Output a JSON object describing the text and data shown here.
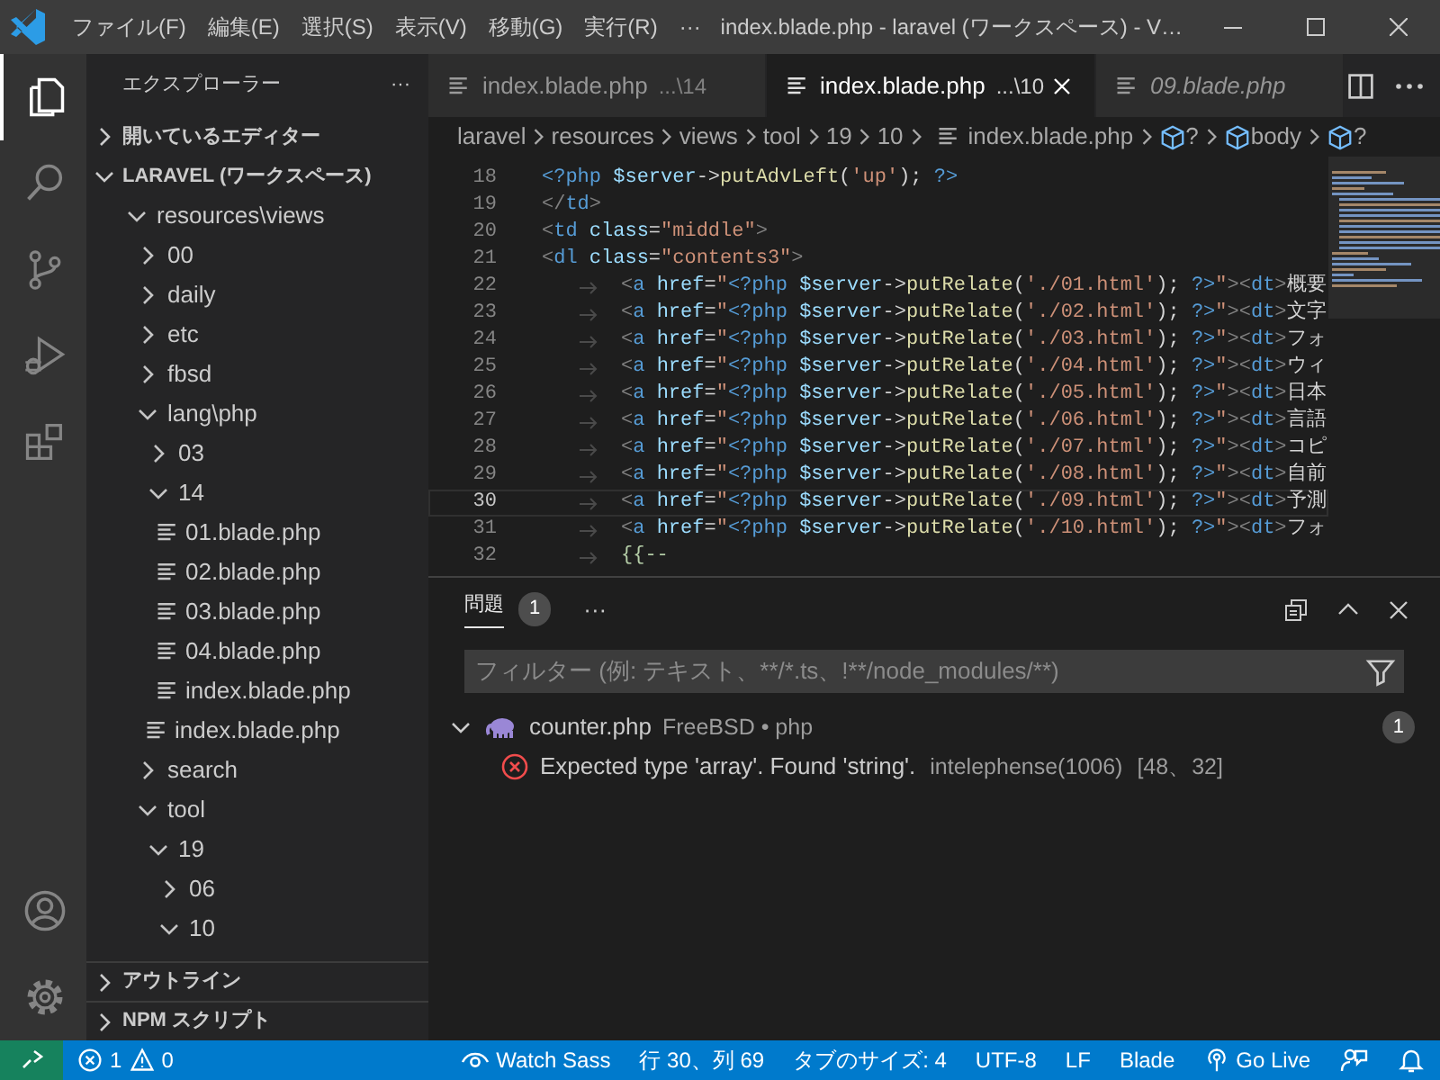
{
  "title_bar": {
    "menu": [
      "ファイル(F)",
      "編集(E)",
      "選択(S)",
      "表示(V)",
      "移動(G)",
      "実行(R)"
    ],
    "more": "···",
    "title": "index.blade.php - laravel (ワークスペース) - V…"
  },
  "activity_bar": {
    "top": [
      {
        "kind": "explorer",
        "selected": true
      },
      {
        "kind": "search",
        "selected": false
      },
      {
        "kind": "source-control",
        "selected": false
      },
      {
        "kind": "debug",
        "selected": false
      },
      {
        "kind": "extensions",
        "selected": false
      }
    ],
    "bottom": [
      {
        "kind": "account"
      },
      {
        "kind": "settings"
      }
    ]
  },
  "sidebar": {
    "title": "エクスプローラー",
    "more": "···",
    "open_editors": {
      "label": "開いているエディター",
      "expanded": false
    },
    "workspace": {
      "label": "LARAVEL (ワークスペース)",
      "expanded": true,
      "tree": [
        {
          "label": "resources\\views",
          "kind": "folder",
          "expanded": true,
          "children": [
            {
              "label": "00",
              "kind": "folder",
              "expanded": false
            },
            {
              "label": "daily",
              "kind": "folder",
              "expanded": false
            },
            {
              "label": "etc",
              "kind": "folder",
              "expanded": false
            },
            {
              "label": "fbsd",
              "kind": "folder",
              "expanded": false
            },
            {
              "label": "lang\\php",
              "kind": "folder",
              "expanded": true,
              "children": [
                {
                  "label": "03",
                  "kind": "folder",
                  "expanded": false
                },
                {
                  "label": "14",
                  "kind": "folder",
                  "expanded": true,
                  "children": [
                    {
                      "label": "01.blade.php",
                      "kind": "file"
                    },
                    {
                      "label": "02.blade.php",
                      "kind": "file"
                    },
                    {
                      "label": "03.blade.php",
                      "kind": "file"
                    },
                    {
                      "label": "04.blade.php",
                      "kind": "file"
                    },
                    {
                      "label": "index.blade.php",
                      "kind": "file"
                    }
                  ]
                },
                {
                  "label": "index.blade.php",
                  "kind": "file"
                }
              ]
            },
            {
              "label": "search",
              "kind": "folder",
              "expanded": false
            },
            {
              "label": "tool",
              "kind": "folder",
              "expanded": true,
              "children": [
                {
                  "label": "19",
                  "kind": "folder",
                  "expanded": true,
                  "children": [
                    {
                      "label": "06",
                      "kind": "folder",
                      "expanded": false
                    },
                    {
                      "label": "10",
                      "kind": "folder",
                      "expanded": true
                    }
                  ]
                }
              ]
            }
          ]
        }
      ]
    },
    "bottom_sections": [
      {
        "label": "アウトライン",
        "expanded": false
      },
      {
        "label": "NPM スクリプト",
        "expanded": false
      }
    ]
  },
  "editor": {
    "tabs": [
      {
        "label": "index.blade.php",
        "description": "...\\14",
        "selected": false,
        "preview": false
      },
      {
        "label": "index.blade.php",
        "description": "...\\10",
        "selected": true,
        "preview": false
      },
      {
        "label": "09.blade.php",
        "selected": false,
        "preview": true
      }
    ],
    "breadcrumb": [
      {
        "label": "laravel",
        "kind": "folder"
      },
      {
        "label": "resources",
        "kind": "folder"
      },
      {
        "label": "views",
        "kind": "folder"
      },
      {
        "label": "tool",
        "kind": "folder"
      },
      {
        "label": "19",
        "kind": "folder"
      },
      {
        "label": "10",
        "kind": "folder"
      },
      {
        "label": "index.blade.php",
        "kind": "file"
      },
      {
        "label": "?",
        "kind": "symbol"
      },
      {
        "label": "body",
        "kind": "symbol"
      },
      {
        "label": "?",
        "kind": "symbol"
      }
    ],
    "lines": [
      {
        "number": "18",
        "indent": false,
        "current": false,
        "tokens": [
          {
            "text": "<?php",
            "kind": "tag"
          },
          {
            "text": " $server",
            "kind": "var"
          },
          {
            "text": "->",
            "kind": "op"
          },
          {
            "text": "putAdvLeft",
            "kind": "fn"
          },
          {
            "text": "(",
            "kind": "op"
          },
          {
            "text": "'up'",
            "kind": "str"
          },
          {
            "text": ");",
            "kind": "op"
          },
          {
            "text": " ?>",
            "kind": "tag"
          }
        ]
      },
      {
        "number": "19",
        "indent": false,
        "current": false,
        "tokens": [
          {
            "text": "</",
            "kind": "punc"
          },
          {
            "text": "td",
            "kind": "tag"
          },
          {
            "text": ">",
            "kind": "punc"
          }
        ]
      },
      {
        "number": "20",
        "indent": false,
        "current": false,
        "tokens": [
          {
            "text": "<",
            "kind": "punc"
          },
          {
            "text": "td",
            "kind": "tag"
          },
          {
            "text": " class",
            "kind": "attr"
          },
          {
            "text": "=",
            "kind": "op"
          },
          {
            "text": "\"middle\"",
            "kind": "str"
          },
          {
            "text": ">",
            "kind": "punc"
          }
        ]
      },
      {
        "number": "21",
        "indent": false,
        "current": false,
        "tokens": [
          {
            "text": "<",
            "kind": "punc"
          },
          {
            "text": "dl",
            "kind": "tag"
          },
          {
            "text": " class",
            "kind": "attr"
          },
          {
            "text": "=",
            "kind": "op"
          },
          {
            "text": "\"contents3\"",
            "kind": "str"
          },
          {
            "text": ">",
            "kind": "punc"
          }
        ]
      },
      {
        "number": "22",
        "indent": true,
        "current": false,
        "tokens": [
          {
            "text": "<",
            "kind": "punc"
          },
          {
            "text": "a",
            "kind": "tag"
          },
          {
            "text": " href",
            "kind": "attr"
          },
          {
            "text": "=",
            "kind": "op"
          },
          {
            "text": "\"",
            "kind": "str"
          },
          {
            "text": "<?php",
            "kind": "tag"
          },
          {
            "text": " $server",
            "kind": "var"
          },
          {
            "text": "->",
            "kind": "op"
          },
          {
            "text": "putRelate",
            "kind": "fn"
          },
          {
            "text": "(",
            "kind": "op"
          },
          {
            "text": "'./01.html'",
            "kind": "str"
          },
          {
            "text": ");",
            "kind": "op"
          },
          {
            "text": " ?>",
            "kind": "tag"
          },
          {
            "text": "\"",
            "kind": "str"
          },
          {
            "text": "><",
            "kind": "punc"
          },
          {
            "text": "dt",
            "kind": "tag"
          },
          {
            "text": ">",
            "kind": "punc"
          },
          {
            "text": "概要",
            "kind": "text"
          }
        ]
      },
      {
        "number": "23",
        "indent": true,
        "current": false,
        "tokens": [
          {
            "text": "<",
            "kind": "punc"
          },
          {
            "text": "a",
            "kind": "tag"
          },
          {
            "text": " href",
            "kind": "attr"
          },
          {
            "text": "=",
            "kind": "op"
          },
          {
            "text": "\"",
            "kind": "str"
          },
          {
            "text": "<?php",
            "kind": "tag"
          },
          {
            "text": " $server",
            "kind": "var"
          },
          {
            "text": "->",
            "kind": "op"
          },
          {
            "text": "putRelate",
            "kind": "fn"
          },
          {
            "text": "(",
            "kind": "op"
          },
          {
            "text": "'./02.html'",
            "kind": "str"
          },
          {
            "text": ");",
            "kind": "op"
          },
          {
            "text": " ?>",
            "kind": "tag"
          },
          {
            "text": "\"",
            "kind": "str"
          },
          {
            "text": "><",
            "kind": "punc"
          },
          {
            "text": "dt",
            "kind": "tag"
          },
          {
            "text": ">",
            "kind": "punc"
          },
          {
            "text": "文字",
            "kind": "text"
          }
        ]
      },
      {
        "number": "24",
        "indent": true,
        "current": false,
        "tokens": [
          {
            "text": "<",
            "kind": "punc"
          },
          {
            "text": "a",
            "kind": "tag"
          },
          {
            "text": " href",
            "kind": "attr"
          },
          {
            "text": "=",
            "kind": "op"
          },
          {
            "text": "\"",
            "kind": "str"
          },
          {
            "text": "<?php",
            "kind": "tag"
          },
          {
            "text": " $server",
            "kind": "var"
          },
          {
            "text": "->",
            "kind": "op"
          },
          {
            "text": "putRelate",
            "kind": "fn"
          },
          {
            "text": "(",
            "kind": "op"
          },
          {
            "text": "'./03.html'",
            "kind": "str"
          },
          {
            "text": ");",
            "kind": "op"
          },
          {
            "text": " ?>",
            "kind": "tag"
          },
          {
            "text": "\"",
            "kind": "str"
          },
          {
            "text": "><",
            "kind": "punc"
          },
          {
            "text": "dt",
            "kind": "tag"
          },
          {
            "text": ">",
            "kind": "punc"
          },
          {
            "text": "フォ",
            "kind": "text"
          }
        ]
      },
      {
        "number": "25",
        "indent": true,
        "current": false,
        "tokens": [
          {
            "text": "<",
            "kind": "punc"
          },
          {
            "text": "a",
            "kind": "tag"
          },
          {
            "text": " href",
            "kind": "attr"
          },
          {
            "text": "=",
            "kind": "op"
          },
          {
            "text": "\"",
            "kind": "str"
          },
          {
            "text": "<?php",
            "kind": "tag"
          },
          {
            "text": " $server",
            "kind": "var"
          },
          {
            "text": "->",
            "kind": "op"
          },
          {
            "text": "putRelate",
            "kind": "fn"
          },
          {
            "text": "(",
            "kind": "op"
          },
          {
            "text": "'./04.html'",
            "kind": "str"
          },
          {
            "text": ");",
            "kind": "op"
          },
          {
            "text": " ?>",
            "kind": "tag"
          },
          {
            "text": "\"",
            "kind": "str"
          },
          {
            "text": "><",
            "kind": "punc"
          },
          {
            "text": "dt",
            "kind": "tag"
          },
          {
            "text": ">",
            "kind": "punc"
          },
          {
            "text": "ウィ",
            "kind": "text"
          }
        ]
      },
      {
        "number": "26",
        "indent": true,
        "current": false,
        "tokens": [
          {
            "text": "<",
            "kind": "punc"
          },
          {
            "text": "a",
            "kind": "tag"
          },
          {
            "text": " href",
            "kind": "attr"
          },
          {
            "text": "=",
            "kind": "op"
          },
          {
            "text": "\"",
            "kind": "str"
          },
          {
            "text": "<?php",
            "kind": "tag"
          },
          {
            "text": " $server",
            "kind": "var"
          },
          {
            "text": "->",
            "kind": "op"
          },
          {
            "text": "putRelate",
            "kind": "fn"
          },
          {
            "text": "(",
            "kind": "op"
          },
          {
            "text": "'./05.html'",
            "kind": "str"
          },
          {
            "text": ");",
            "kind": "op"
          },
          {
            "text": " ?>",
            "kind": "tag"
          },
          {
            "text": "\"",
            "kind": "str"
          },
          {
            "text": "><",
            "kind": "punc"
          },
          {
            "text": "dt",
            "kind": "tag"
          },
          {
            "text": ">",
            "kind": "punc"
          },
          {
            "text": "日本",
            "kind": "text"
          }
        ]
      },
      {
        "number": "27",
        "indent": true,
        "current": false,
        "tokens": [
          {
            "text": "<",
            "kind": "punc"
          },
          {
            "text": "a",
            "kind": "tag"
          },
          {
            "text": " href",
            "kind": "attr"
          },
          {
            "text": "=",
            "kind": "op"
          },
          {
            "text": "\"",
            "kind": "str"
          },
          {
            "text": "<?php",
            "kind": "tag"
          },
          {
            "text": " $server",
            "kind": "var"
          },
          {
            "text": "->",
            "kind": "op"
          },
          {
            "text": "putRelate",
            "kind": "fn"
          },
          {
            "text": "(",
            "kind": "op"
          },
          {
            "text": "'./06.html'",
            "kind": "str"
          },
          {
            "text": ");",
            "kind": "op"
          },
          {
            "text": " ?>",
            "kind": "tag"
          },
          {
            "text": "\"",
            "kind": "str"
          },
          {
            "text": "><",
            "kind": "punc"
          },
          {
            "text": "dt",
            "kind": "tag"
          },
          {
            "text": ">",
            "kind": "punc"
          },
          {
            "text": "言語",
            "kind": "text"
          }
        ]
      },
      {
        "number": "28",
        "indent": true,
        "current": false,
        "tokens": [
          {
            "text": "<",
            "kind": "punc"
          },
          {
            "text": "a",
            "kind": "tag"
          },
          {
            "text": " href",
            "kind": "attr"
          },
          {
            "text": "=",
            "kind": "op"
          },
          {
            "text": "\"",
            "kind": "str"
          },
          {
            "text": "<?php",
            "kind": "tag"
          },
          {
            "text": " $server",
            "kind": "var"
          },
          {
            "text": "->",
            "kind": "op"
          },
          {
            "text": "putRelate",
            "kind": "fn"
          },
          {
            "text": "(",
            "kind": "op"
          },
          {
            "text": "'./07.html'",
            "kind": "str"
          },
          {
            "text": ");",
            "kind": "op"
          },
          {
            "text": " ?>",
            "kind": "tag"
          },
          {
            "text": "\"",
            "kind": "str"
          },
          {
            "text": "><",
            "kind": "punc"
          },
          {
            "text": "dt",
            "kind": "tag"
          },
          {
            "text": ">",
            "kind": "punc"
          },
          {
            "text": "コピ",
            "kind": "text"
          }
        ]
      },
      {
        "number": "29",
        "indent": true,
        "current": false,
        "tokens": [
          {
            "text": "<",
            "kind": "punc"
          },
          {
            "text": "a",
            "kind": "tag"
          },
          {
            "text": " href",
            "kind": "attr"
          },
          {
            "text": "=",
            "kind": "op"
          },
          {
            "text": "\"",
            "kind": "str"
          },
          {
            "text": "<?php",
            "kind": "tag"
          },
          {
            "text": " $server",
            "kind": "var"
          },
          {
            "text": "->",
            "kind": "op"
          },
          {
            "text": "putRelate",
            "kind": "fn"
          },
          {
            "text": "(",
            "kind": "op"
          },
          {
            "text": "'./08.html'",
            "kind": "str"
          },
          {
            "text": ");",
            "kind": "op"
          },
          {
            "text": " ?>",
            "kind": "tag"
          },
          {
            "text": "\"",
            "kind": "str"
          },
          {
            "text": "><",
            "kind": "punc"
          },
          {
            "text": "dt",
            "kind": "tag"
          },
          {
            "text": ">",
            "kind": "punc"
          },
          {
            "text": "自前",
            "kind": "text"
          }
        ]
      },
      {
        "number": "30",
        "indent": true,
        "current": true,
        "tokens": [
          {
            "text": "<",
            "kind": "punc"
          },
          {
            "text": "a",
            "kind": "tag"
          },
          {
            "text": " href",
            "kind": "attr"
          },
          {
            "text": "=",
            "kind": "op"
          },
          {
            "text": "\"",
            "kind": "str"
          },
          {
            "text": "<?php",
            "kind": "tag"
          },
          {
            "text": " $server",
            "kind": "var"
          },
          {
            "text": "->",
            "kind": "op"
          },
          {
            "text": "putRelate",
            "kind": "fn"
          },
          {
            "text": "(",
            "kind": "op"
          },
          {
            "text": "'./09.html'",
            "kind": "str"
          },
          {
            "text": ");",
            "kind": "op"
          },
          {
            "text": " ?>",
            "kind": "tag"
          },
          {
            "text": "\"",
            "kind": "str"
          },
          {
            "text": "><",
            "kind": "punc"
          },
          {
            "text": "dt",
            "kind": "tag"
          },
          {
            "text": ">",
            "kind": "punc"
          },
          {
            "text": "予測",
            "kind": "text"
          }
        ]
      },
      {
        "number": "31",
        "indent": true,
        "current": false,
        "tokens": [
          {
            "text": "<",
            "kind": "punc"
          },
          {
            "text": "a",
            "kind": "tag"
          },
          {
            "text": " href",
            "kind": "attr"
          },
          {
            "text": "=",
            "kind": "op"
          },
          {
            "text": "\"",
            "kind": "str"
          },
          {
            "text": "<?php",
            "kind": "tag"
          },
          {
            "text": " $server",
            "kind": "var"
          },
          {
            "text": "->",
            "kind": "op"
          },
          {
            "text": "putRelate",
            "kind": "fn"
          },
          {
            "text": "(",
            "kind": "op"
          },
          {
            "text": "'./10.html'",
            "kind": "str"
          },
          {
            "text": ");",
            "kind": "op"
          },
          {
            "text": " ?>",
            "kind": "tag"
          },
          {
            "text": "\"",
            "kind": "str"
          },
          {
            "text": "><",
            "kind": "punc"
          },
          {
            "text": "dt",
            "kind": "tag"
          },
          {
            "text": ">",
            "kind": "punc"
          },
          {
            "text": "フォ",
            "kind": "text"
          }
        ]
      },
      {
        "number": "32",
        "indent": true,
        "current": false,
        "tokens": [
          {
            "text": "{{--",
            "kind": "comment"
          }
        ]
      }
    ]
  },
  "panel": {
    "tabs": [
      {
        "label": "問題",
        "count": "1",
        "selected": true
      }
    ],
    "more": "···",
    "filter": {
      "placeholder": "フィルター (例: テキスト、**/*.ts、!**/node_modules/**)"
    },
    "problems": [
      {
        "file": "counter.php",
        "detail": "FreeBSD • php",
        "count": "1",
        "expanded": true,
        "items": [
          {
            "kind": "error",
            "message": "Expected type 'array'. Found 'string'.",
            "source": "intelephense(1006)",
            "location": "[48、32]"
          }
        ]
      }
    ]
  },
  "status_bar": {
    "errors": "1",
    "warnings": "0",
    "items": [
      {
        "kind": "watch",
        "label": "Watch Sass"
      },
      {
        "kind": "text",
        "label": "行 30、列 69"
      },
      {
        "kind": "text",
        "label": "タブのサイズ: 4"
      },
      {
        "kind": "text",
        "label": "UTF-8"
      },
      {
        "kind": "text",
        "label": "LF"
      },
      {
        "kind": "text",
        "label": "Blade"
      },
      {
        "kind": "live",
        "label": "Go Live"
      },
      {
        "kind": "feedback"
      },
      {
        "kind": "bell"
      }
    ]
  }
}
